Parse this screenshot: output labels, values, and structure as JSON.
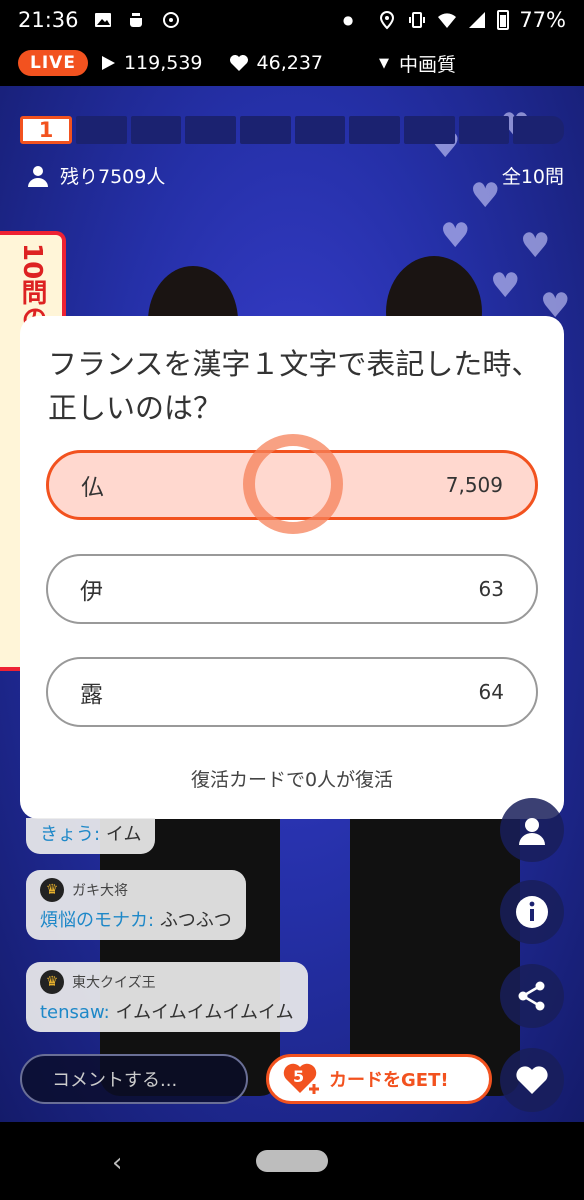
{
  "status_bar": {
    "time": "21:36",
    "battery": "77%"
  },
  "stats": {
    "live_label": "LIVE",
    "views": "119,539",
    "likes": "46,237",
    "quality": "中画質"
  },
  "progress": {
    "current": "1",
    "total_segments": 10
  },
  "remaining": "残り7509人",
  "total_questions": "全10問",
  "quiz": {
    "question": "フランスを漢字１文字で表記した時、正しいのは？",
    "options": [
      {
        "label": "仏",
        "count": "7,509",
        "selected": true
      },
      {
        "label": "伊",
        "count": "63",
        "selected": false
      },
      {
        "label": "露",
        "count": "64",
        "selected": false
      }
    ],
    "revive_text": "復活カードで0人が復活"
  },
  "comments": [
    {
      "user": "きょう:",
      "text": "イム",
      "rank": ""
    },
    {
      "rank": "ガキ大将",
      "user": "煩悩のモナカ:",
      "text": "ふつふつ"
    },
    {
      "rank": "東大クイズ王",
      "user": "tensaw:",
      "text": "イムイムイムイムイム"
    }
  ],
  "comment_input_placeholder": "コメントする...",
  "card_button": {
    "count": "5",
    "label": "カードをGET!"
  },
  "banner_text": "10問の",
  "colors": {
    "accent": "#f2521f",
    "stage": "#2530a8",
    "selected_fill": "#ffd8cf",
    "username": "#1e88c8"
  },
  "icons": [
    "image-icon",
    "cup-icon",
    "signal-on-icon",
    "location-icon",
    "vibrate-icon",
    "wifi-icon",
    "cell-signal-icon",
    "battery-icon",
    "play-icon",
    "heart-icon",
    "dropdown-icon",
    "person-icon",
    "info-icon",
    "share-icon",
    "heart-button-icon",
    "back-icon",
    "home-pill"
  ]
}
